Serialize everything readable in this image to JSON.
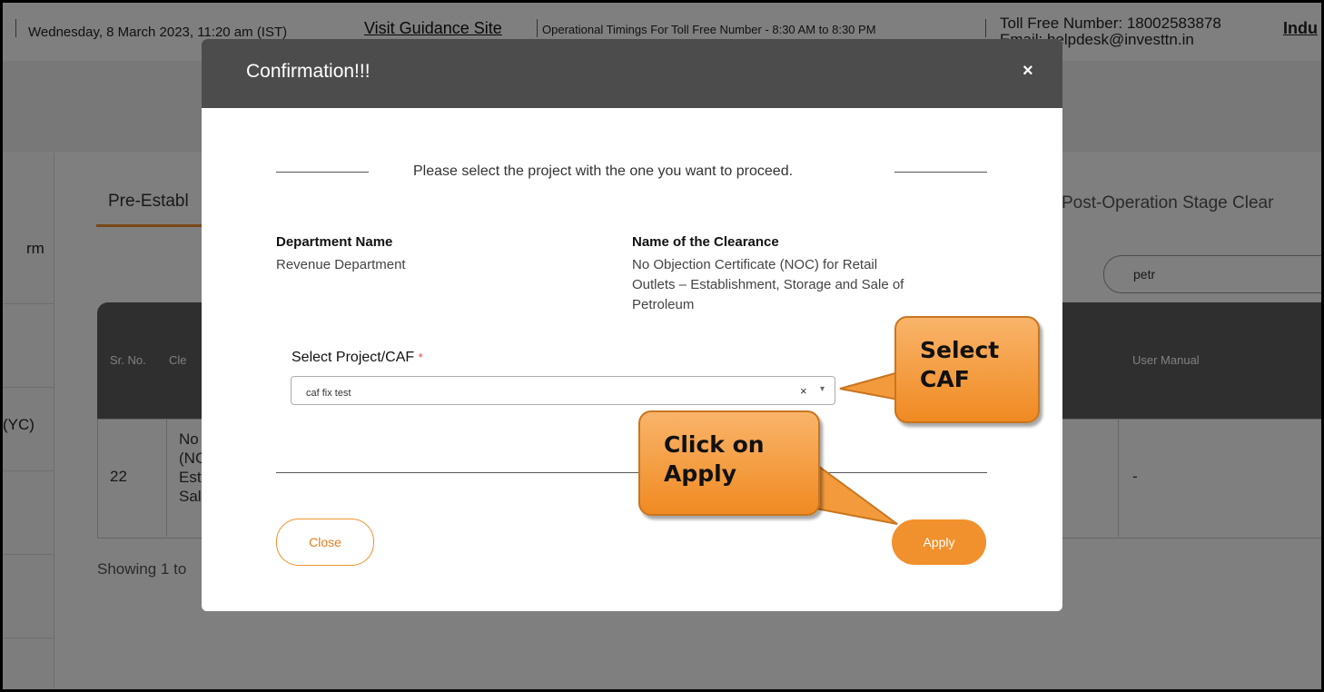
{
  "topbar": {
    "date": "Wednesday, 8 March 2023, 11:20 am (IST)",
    "guidance_link": "Visit Guidance Site",
    "timings": "Operational Timings For Toll Free Number - 8:30 AM to 8:30 PM",
    "toll_free": "Toll Free Number: 18002583878",
    "email": "Email: helpdesk@investtn.in",
    "industry_link": "Indu"
  },
  "leftnav": {
    "item1": "rm",
    "item2": "(YC)"
  },
  "tabs": {
    "pre": "Pre-Establ",
    "post": "Post-Operation Stage Clear"
  },
  "search": {
    "value": "petr"
  },
  "table": {
    "headers": {
      "sr": "Sr. No.",
      "clearance": "Cle",
      "user_manual": "User Manual"
    },
    "row": {
      "sr": "22",
      "name_lines": [
        "No",
        "(NC",
        "Est",
        "Sal"
      ],
      "user_manual": "-"
    }
  },
  "showing": "Showing 1 to",
  "modal": {
    "title": "Confirmation!!!",
    "close_x": "×",
    "intro": "Please select the project with the one you want to proceed.",
    "dept_label": "Department Name",
    "dept_value": "Revenue Department",
    "clearance_label": "Name of the Clearance",
    "clearance_value_lines": [
      "No Objection Certificate (NOC) for Retail",
      "Outlets – Establishment, Storage and Sale of",
      "Petroleum"
    ],
    "select_label": "Select Project/CAF",
    "required_mark": "*",
    "select_value": "caf fix test",
    "select_clear": "×",
    "select_arrow": "▾",
    "close_button": "Close",
    "apply_button": "Apply"
  },
  "callouts": {
    "select_caf": [
      "Select",
      "CAF"
    ],
    "click_apply": [
      "Click on",
      "Apply"
    ]
  },
  "colors": {
    "accent": "#f0912d",
    "header": "#4c4c4c",
    "callout": "#f5a04a"
  }
}
